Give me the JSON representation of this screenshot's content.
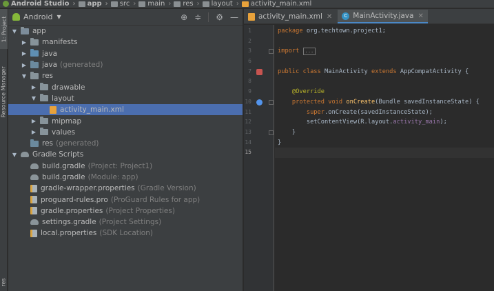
{
  "breadcrumb": [
    "Android Studio",
    "app",
    "src",
    "main",
    "res",
    "layout",
    "activity_main.xml"
  ],
  "side_tabs": [
    "1: Project",
    "Resource Manager",
    "res"
  ],
  "project_panel": {
    "view_label": "Android",
    "tree": [
      {
        "label": "app",
        "suffix": "",
        "icon": "module-folder-icon",
        "level": 0,
        "arrow": "▼"
      },
      {
        "label": "manifests",
        "suffix": "",
        "icon": "folder-icon",
        "level": 1,
        "arrow": "▶"
      },
      {
        "label": "java",
        "suffix": "",
        "icon": "java-folder-icon",
        "level": 1,
        "arrow": "▶"
      },
      {
        "label": "java",
        "suffix": "(generated)",
        "icon": "generated-folder-icon",
        "level": 1,
        "arrow": "▶"
      },
      {
        "label": "res",
        "suffix": "",
        "icon": "res-folder-icon",
        "level": 1,
        "arrow": "▼"
      },
      {
        "label": "drawable",
        "suffix": "",
        "icon": "folder-icon",
        "level": 2,
        "arrow": "▶"
      },
      {
        "label": "layout",
        "suffix": "",
        "icon": "folder-icon",
        "level": 2,
        "arrow": "▼"
      },
      {
        "label": "activity_main.xml",
        "suffix": "",
        "icon": "xml-file-icon",
        "level": 3,
        "arrow": "",
        "selected": true
      },
      {
        "label": "mipmap",
        "suffix": "",
        "icon": "folder-icon",
        "level": 2,
        "arrow": "▶"
      },
      {
        "label": "values",
        "suffix": "",
        "icon": "folder-icon",
        "level": 2,
        "arrow": "▶"
      },
      {
        "label": "res",
        "suffix": "(generated)",
        "icon": "generated-folder-icon",
        "level": 1,
        "arrow": ""
      },
      {
        "label": "Gradle Scripts",
        "suffix": "",
        "icon": "gradle-icon",
        "level": 0,
        "arrow": "▼"
      },
      {
        "label": "build.gradle",
        "suffix": "(Project: Project1)",
        "icon": "gradle-icon",
        "level": 1,
        "arrow": ""
      },
      {
        "label": "build.gradle",
        "suffix": "(Module: app)",
        "icon": "gradle-icon",
        "level": 1,
        "arrow": ""
      },
      {
        "label": "gradle-wrapper.properties",
        "suffix": "(Gradle Version)",
        "icon": "properties-file-icon",
        "level": 1,
        "arrow": ""
      },
      {
        "label": "proguard-rules.pro",
        "suffix": "(ProGuard Rules for app)",
        "icon": "properties-file-icon",
        "level": 1,
        "arrow": ""
      },
      {
        "label": "gradle.properties",
        "suffix": "(Project Properties)",
        "icon": "properties-file-icon",
        "level": 1,
        "arrow": ""
      },
      {
        "label": "settings.gradle",
        "suffix": "(Project Settings)",
        "icon": "gradle-icon",
        "level": 1,
        "arrow": ""
      },
      {
        "label": "local.properties",
        "suffix": "(SDK Location)",
        "icon": "properties-file-icon",
        "level": 1,
        "arrow": ""
      }
    ]
  },
  "editor": {
    "tabs": [
      {
        "label": "activity_main.xml",
        "icon": "xml-file-icon",
        "active": false
      },
      {
        "label": "MainActivity.java",
        "icon": "class-icon",
        "active": true
      }
    ],
    "class_icon_letter": "C",
    "fold_placeholder": "...",
    "line_numbers": [
      "1",
      "2",
      "3",
      "6",
      "7",
      "8",
      "9",
      "10",
      "11",
      "12",
      "13",
      "14",
      "15"
    ],
    "code": {
      "l1_kw": "package",
      "l1_rest": " org.techtown.project1;",
      "l3_kw": "import",
      "l7_kw": "public class",
      "l7_name": " MainActivity ",
      "l7_kw2": "extends",
      "l7_rest": " AppCompatActivity {",
      "l9_ann": "@Override",
      "l10_kw": "protected void",
      "l10_fn": " onCreate",
      "l10_rest": "(Bundle savedInstanceState) {",
      "l11_kw": "super",
      "l11_rest": ".onCreate(savedInstanceState);",
      "l12_pre": "setContentView(R.layout.",
      "l12_fld": "activity_main",
      "l12_post": ");",
      "l13": "}",
      "l14": "}"
    }
  },
  "colors": {
    "selection": "#4b6eaf",
    "keyword": "#cc7832",
    "annotation": "#bbb529",
    "method": "#ffc66d",
    "field": "#9876aa"
  }
}
